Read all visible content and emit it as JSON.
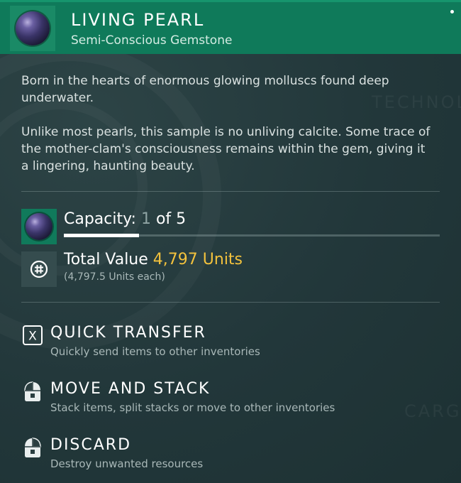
{
  "item": {
    "title": "LIVING PEARL",
    "subtitle": "Semi-Conscious Gemstone",
    "icon": "living-pearl"
  },
  "description": {
    "paragraph1": "Born in the hearts of enormous glowing molluscs found deep underwater.",
    "paragraph2": "Unlike most pearls, this sample is no unliving calcite. Some trace of the mother-clam's consciousness remains within the gem, giving it a lingering, haunting beauty."
  },
  "capacity": {
    "label": "Capacity:",
    "current": "1",
    "of_text": "of 5",
    "fill_fraction": 0.2
  },
  "value": {
    "label": "Total Value",
    "amount": "4,797 Units",
    "each": "(4,797.5 Units each)",
    "icon": "units-currency"
  },
  "actions": [
    {
      "key": "X",
      "title": "QUICK TRANSFER",
      "desc": "Quickly send items to other inventories",
      "icon": "key-x"
    },
    {
      "title": "MOVE AND STACK",
      "desc": "Stack items, split stacks or move to other inventories",
      "icon": "mouse-left"
    },
    {
      "title": "DISCARD",
      "desc": "Destroy unwanted resources",
      "icon": "mouse-right"
    }
  ],
  "watermarks": [
    "TECHNOL",
    "CARGO"
  ],
  "colors": {
    "header": "#0f7a5a",
    "accent_value": "#f3c23d",
    "background": "#263a3c"
  }
}
